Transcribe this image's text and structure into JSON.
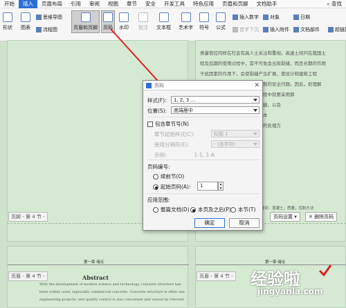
{
  "menu": [
    "开始",
    "插入",
    "页面布局",
    "引用",
    "审阅",
    "视图",
    "章节",
    "安全",
    "开发工具",
    "特色应用",
    "页眉和页脚",
    "文档助手"
  ],
  "menu_active_index": 1,
  "search_label": "查找",
  "ribbon": {
    "shape": "形状",
    "chart": "图表",
    "mindmap": "思维导图",
    "flowchart": "流程图",
    "header_footer": "页眉和页脚",
    "page_number": "页码",
    "watermark": "水印",
    "comment": "批注",
    "textbox": "文本框",
    "wordart": "艺术字",
    "symbol": "符号",
    "formula": "公式",
    "insert_number": "插入数字",
    "object": "对象",
    "date": "日期",
    "first_letter": "首字下沉",
    "attachment": "插入附件",
    "doc_parts": "文档部件",
    "hyperlink": "超链接"
  },
  "dialog": {
    "title": "页码",
    "style_label": "样式(F):",
    "style_value": "1, 2, 3 ...",
    "position_label": "位置(S):",
    "position_value": "底端居中",
    "include_chapter": "包含章节号(N)",
    "chapter_start_label": "章节起始样式(C):",
    "chapter_start_value": "标题 1",
    "separator_label": "使用分隔符(E):",
    "separator_value": "- (连字符)",
    "example_label": "示例:",
    "example_value": "1-1, 1-A",
    "numbering_header": "页码编号:",
    "continue_label": "续前节(O)",
    "start_label": "起始页码(A):",
    "start_value": "1",
    "scope_header": "应用范围:",
    "scope_whole": "整篇文档(D)",
    "scope_this_after": "本页及之后(P)",
    "scope_section": "本节(T)",
    "ok": "确定",
    "cancel": "取消"
  },
  "footer": {
    "label": "页脚 - 第 4 节 -",
    "page_settings": "页码设置",
    "delete_page_number": "删除页码",
    "header_label": "页眉 - 第 4 节 -"
  },
  "document": {
    "lines": [
      "质量管控同样在社会有具人士关注和重视。高速土结问在我国土",
      "程及后期的使用过程中，首不可免会出现裂缝，而且长期的作用",
      "干扰因素的作用下，会使裂缝产生扩展，使设计和建筑工程",
      "使用年限，甚至导致工程主体机制的安全问题。因此，处理解",
      "结构的管理和，在应用高速土过程中就要采用那",
      "混凝工程项目量免出现混凝土裂缝，以及",
      "方法，减少建筑物的安全隐患，本",
      "中的成因及控制对策，针对有效的处理方",
      "增强工程的质量和安全保障。"
    ],
    "keywords_line": "关键词：混凝土；质量；控制方法",
    "abstract_title": "Abstract",
    "abstract_lines": [
      "With the development of modern science and technology, concrete structure has",
      "been widely used, especially commercial concrete. Concrete structure is often used in",
      "engineering projects, and quality control is also concerned and valued by relevant"
    ],
    "section_header": "第一章 绪论"
  },
  "watermark": "经验啦",
  "watermark_url": "jingyanla.com",
  "colors": {
    "accent": "#2b6fd6",
    "arrow": "#e02020",
    "page_bg": "#d6ead3"
  }
}
